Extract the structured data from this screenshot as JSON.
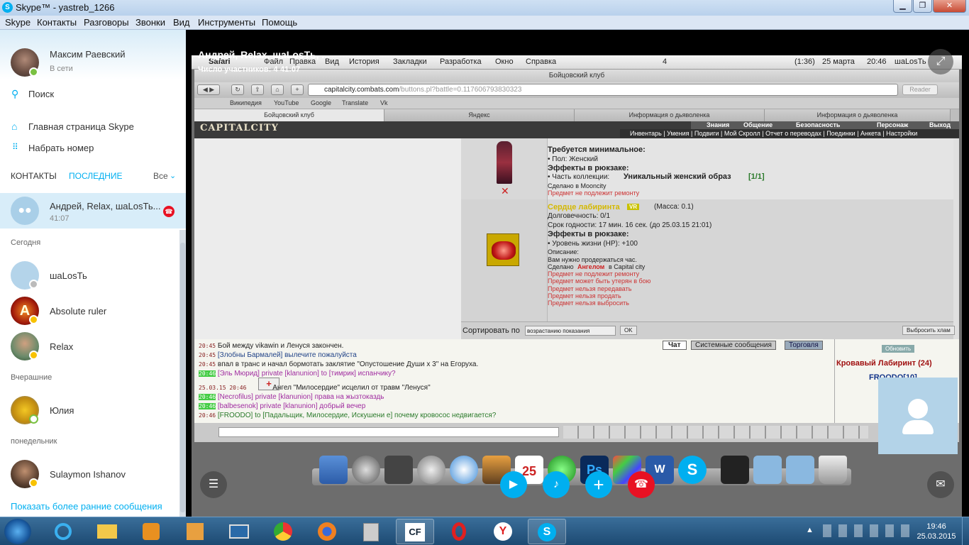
{
  "window": {
    "title": "Skype™ - yastreb_1266"
  },
  "menu": [
    "Skype",
    "Контакты",
    "Разговоры",
    "Звонки",
    "Вид",
    "Инструменты",
    "Помощь"
  ],
  "profile": {
    "name": "Максим Раевский",
    "status": "В сети"
  },
  "nav": {
    "search": "Поиск",
    "home": "Главная страница Skype",
    "dial": "Набрать номер"
  },
  "tabs": {
    "contacts": "КОНТАКТЫ",
    "recent": "ПОСЛЕДНИЕ",
    "filter": "Все"
  },
  "active_call": {
    "name": "Андрей, Relax, шаLosТь...",
    "duration": "41:07"
  },
  "sections": {
    "today": "Сегодня",
    "yesterday": "Вчерашние",
    "monday": "понедельник"
  },
  "contacts": {
    "c1": "шаLosТь",
    "c2": "Absolute ruler",
    "c3": "Relax",
    "c4": "Юлия",
    "c5": "Sulaymon Ishanov"
  },
  "show_more": "Показать более ранние сообщения",
  "call": {
    "title": "Андрей, Relax, шаLosТь, ...",
    "participants": "Число участников: 4",
    "timer": "41:07"
  },
  "mac": {
    "menu": [
      "Safari",
      "Файл",
      "Правка",
      "Вид",
      "История",
      "Закладки",
      "Разработка",
      "Окно",
      "Справка"
    ],
    "battery": "(1:36)",
    "date": "25 марта",
    "time": "20:46",
    "user": "шаLosТь",
    "count": "4"
  },
  "browser": {
    "title": "Бойцовский клуб",
    "url_host": "capitalcity.combats.com",
    "url_path": "/buttons.pl?battle=0.117606793830323",
    "reader": "Reader",
    "bookmarks": [
      "Википедия",
      "YouTube",
      "Google",
      "Translate",
      "Vk"
    ],
    "tabs": [
      "Бойцовский клуб",
      "Яндекс",
      "Информация о дьяволенка",
      "Информация о дьяволенка"
    ]
  },
  "game": {
    "logo": "CAPITALCITY",
    "menu_top": [
      "Знания",
      "Общение",
      "Безопасность",
      "Персонаж",
      "Выход"
    ],
    "menu_bottom": "Инвентарь | Умения | Подвиги | Мой Скролл | Отчет о переводах | Поединки | Анкета | Настройки",
    "item1": {
      "req": "Требуется минимальное:",
      "gender": "• Пол: Женский",
      "effects": "Эффекты в рюкзаке:",
      "collection_label": "• Часть коллекции:",
      "collection": "Уникальный женский образ",
      "collection_count": "[1/1]",
      "made": "Сделано в Mooncity",
      "norepair": "Предмет не подлежит ремонту"
    },
    "item2": {
      "name": "Сердце лабиринта",
      "badge": "VR",
      "mass": "(Масса: 0.1)",
      "durability": "Долговечность: 0/1",
      "expiry": "Срок годности: 17 мин. 16 сек. (до 25.03.15 21:01)",
      "effects": "Эффекты в рюкзаке:",
      "hp": "• Уровень жизни (HP): +100",
      "desc_label": "Описание:",
      "desc": "Вам нужно продержаться час.",
      "made_prefix": "Сделано",
      "made_by": "Ангелом",
      "made_suffix": "в Capital city",
      "notes": [
        "Предмет не подлежит ремонту",
        "Предмет может быть утерян в бою",
        "Предмет нельзя передавать",
        "Предмет нельзя продать",
        "Предмет нельзя выбросить"
      ]
    },
    "sort": {
      "label": "Сортировать по",
      "value": "возрастанию показания",
      "ok": "OK",
      "junk": "Выбросить хлам"
    },
    "chat_tabs": [
      "Чат",
      "Системные сообщения",
      "Торговля"
    ],
    "chat": [
      {
        "t": "20:45",
        "text": "Бой между vikawin и Ленуся закончен."
      },
      {
        "t": "20:45",
        "text": "[Злобны Бармалей] вылечите пожалуйста"
      },
      {
        "t": "20:45",
        "text": "впал в транс и начал бормотать заклятие \"Опустошение Души х 3\" на Егоруха."
      },
      {
        "t": "20:46",
        "text": "[Эль Мюрид] private [klanunion] to [тимрик] испанчику?"
      },
      {
        "t": "25.03.15 20:46",
        "text": "Ангел \"Милосердие\" исцелил от травм \"Ленуся\""
      },
      {
        "t": "20:46",
        "text": "[Necrofilus] private [klanunion] права на жызтоказдь"
      },
      {
        "t": "20:46",
        "text": "[balbesenok] private [klanunion] добрый вечер"
      },
      {
        "t": "20:46",
        "text": "[FROODO] to [Падальщик, Милосердие, Искушени е] почему кровосос недвигается?"
      }
    ],
    "refresh": "Обновить",
    "room": "Кровавый Лабиринт (24)",
    "player": "FROODO[10]"
  },
  "taskbar": {
    "time": "19:46",
    "date": "25.03.2015"
  }
}
